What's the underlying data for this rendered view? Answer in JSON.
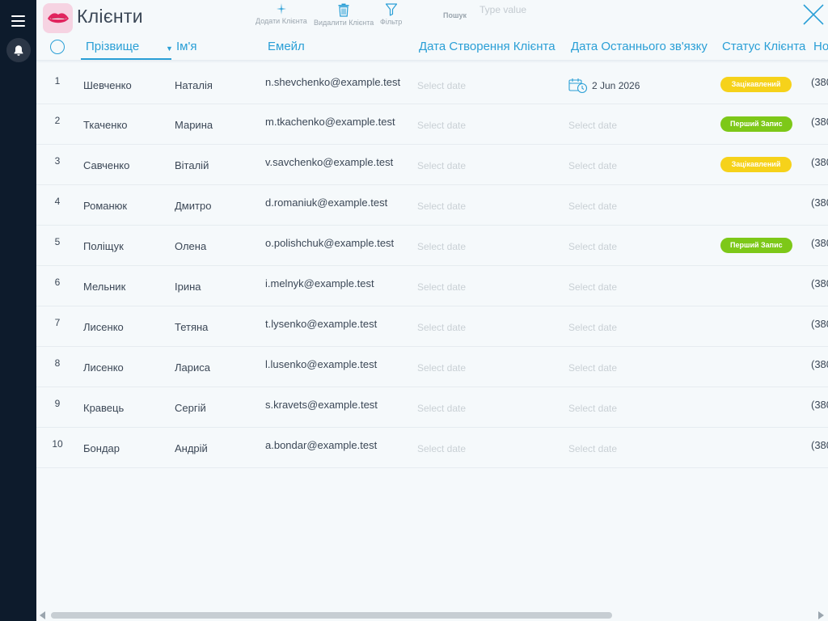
{
  "app": {
    "title": "Клієнти",
    "logo_icon": "lips-icon",
    "accent_color": "#2a9fd6"
  },
  "sidebar": {
    "menu_icon": "hamburger-menu-icon",
    "notifications_icon": "bell-icon"
  },
  "toolbar": {
    "add_label": "Додати Клієнта",
    "delete_label": "Видалити Клієнта",
    "filter_label": "Фільтр",
    "search_label": "Пошук",
    "search_placeholder": "Type value",
    "search_value": ""
  },
  "columns": {
    "last_name": "Прізвище",
    "first_name": "Ім'я",
    "email": "Емейл",
    "created": "Дата Створення Клієнта",
    "last_contact": "Дата Останнього зв'язку",
    "status": "Статус Клієнта",
    "phone": "Но"
  },
  "date_placeholder": "Select date",
  "status_colors": {
    "Зацікавлений": "#f6d21a",
    "Перший Запис": "#7dc818"
  },
  "rows": [
    {
      "num": "1",
      "last": "Шевченко",
      "first": "Наталія",
      "email": "n.shevchenko@example.test",
      "created": "",
      "last_contact": "2 Jun 2026",
      "status": "Зацікавлений",
      "phone": "(380"
    },
    {
      "num": "2",
      "last": "Ткаченко",
      "first": "Марина",
      "email": "m.tkachenko@example.test",
      "created": "",
      "last_contact": "",
      "status": "Перший Запис",
      "phone": "(380"
    },
    {
      "num": "3",
      "last": "Савченко",
      "first": "Віталій",
      "email": "v.savchenko@example.test",
      "created": "",
      "last_contact": "",
      "status": "Зацікавлений",
      "phone": "(380"
    },
    {
      "num": "4",
      "last": "Романюк",
      "first": "Дмитро",
      "email": "d.romaniuk@example.test",
      "created": "",
      "last_contact": "",
      "status": "",
      "phone": "(380"
    },
    {
      "num": "5",
      "last": "Поліщук",
      "first": "Олена",
      "email": "o.polishchuk@example.test",
      "created": "",
      "last_contact": "",
      "status": "Перший Запис",
      "phone": "(380"
    },
    {
      "num": "6",
      "last": "Мельник",
      "first": "Ірина",
      "email": "i.melnyk@example.test",
      "created": "",
      "last_contact": "",
      "status": "",
      "phone": "(380"
    },
    {
      "num": "7",
      "last": "Лисенко",
      "first": "Тетяна",
      "email": "t.lysenko@example.test",
      "created": "",
      "last_contact": "",
      "status": "",
      "phone": "(380"
    },
    {
      "num": "8",
      "last": "Лисенко",
      "first": "Лариса",
      "email": "l.lusenko@example.test",
      "created": "",
      "last_contact": "",
      "status": "",
      "phone": "(380"
    },
    {
      "num": "9",
      "last": "Кравець",
      "first": "Сергій",
      "email": "s.kravets@example.test",
      "created": "",
      "last_contact": "",
      "status": "",
      "phone": "(380"
    },
    {
      "num": "10",
      "last": "Бондар",
      "first": "Андрій",
      "email": "a.bondar@example.test",
      "created": "",
      "last_contact": "",
      "status": "",
      "phone": "(380"
    }
  ]
}
